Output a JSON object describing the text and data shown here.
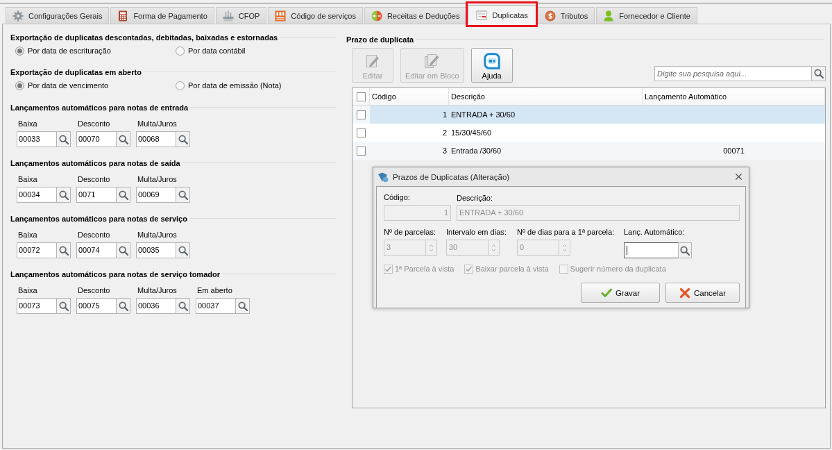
{
  "tabs": [
    {
      "label": "Configurações Gerais",
      "selected": false,
      "highlighted": false
    },
    {
      "label": "Forma de Pagamento",
      "selected": false,
      "highlighted": false
    },
    {
      "label": "CFOP",
      "selected": false,
      "highlighted": false
    },
    {
      "label": "Código de serviços",
      "selected": false,
      "highlighted": false
    },
    {
      "label": "Receitas e Deduções",
      "selected": false,
      "highlighted": false
    },
    {
      "label": "Duplicatas",
      "selected": true,
      "highlighted": true
    },
    {
      "label": "Tributos",
      "selected": false,
      "highlighted": false
    },
    {
      "label": "Fornecedor e Cliente",
      "selected": false,
      "highlighted": false
    }
  ],
  "export_settings": [
    {
      "title": "Exportação de duplicatas descontadas, debitadas, baixadas e estornadas",
      "options": [
        {
          "label": "Por data de escrituração",
          "selected": true
        },
        {
          "label": "Por data contábil",
          "selected": false
        }
      ]
    },
    {
      "title": "Exportação de duplicatas em aberto",
      "options": [
        {
          "label": "Por data de vencimento",
          "selected": true
        },
        {
          "label": "Por data de emissão (Nota)",
          "selected": false
        }
      ]
    }
  ],
  "automatic_entries": [
    {
      "title": "Lançamentos automáticos para notas de entrada",
      "fields": [
        {
          "label": "Baixa",
          "value": "00033"
        },
        {
          "label": "Desconto",
          "value": "00070"
        },
        {
          "label": "Multa/Juros",
          "value": "00068"
        }
      ]
    },
    {
      "title": "Lançamentos automáticos para notas de saída",
      "fields": [
        {
          "label": "Baixa",
          "value": "00034"
        },
        {
          "label": "Desconto",
          "value": "0071"
        },
        {
          "label": "Multa/Juros",
          "value": "00069"
        }
      ]
    },
    {
      "title": "Lançamentos automáticos para notas de serviço",
      "fields": [
        {
          "label": "Baixa",
          "value": "00072"
        },
        {
          "label": "Desconto",
          "value": "00074"
        },
        {
          "label": "Multa/Juros",
          "value": "00035"
        }
      ]
    },
    {
      "title": "Lançamentos automáticos para notas de serviço tomador",
      "fields": [
        {
          "label": "Baixa",
          "value": "00073"
        },
        {
          "label": "Desconto",
          "value": "00075"
        },
        {
          "label": "Multa/Juros",
          "value": "00036"
        },
        {
          "label": "Em aberto",
          "value": "00037"
        }
      ]
    }
  ],
  "due_terms": {
    "title": "Prazo de duplicata",
    "toolbar": [
      {
        "label": "Editar",
        "disabled": true
      },
      {
        "label": "Editar em Bloco",
        "disabled": true
      },
      {
        "label": "Ajuda",
        "disabled": false
      }
    ],
    "search": {
      "placeholder": "Digite sua pesquisa aqui..."
    },
    "table": {
      "header_checked": false,
      "columns": [
        "Código",
        "Descrição",
        "Lançamento Automático"
      ],
      "rows": [
        {
          "checked": false,
          "selected": true,
          "code": "1",
          "description": "ENTRADA + 30/60"
        },
        {
          "checked": false,
          "selected": false,
          "code": "2",
          "description": "15/30/45/60"
        },
        {
          "checked": false,
          "selected": false,
          "code": "3",
          "description": "Entrada /30/60",
          "auto_entry": "00071"
        }
      ]
    }
  },
  "dialog": {
    "title": "Prazos de Duplicatas (Alteração)",
    "code": {
      "label": "Código:",
      "value": "1",
      "disabled": true
    },
    "description": {
      "label": "Descrição:",
      "value": "ENTRADA + 30/60",
      "disabled": true
    },
    "spinners": [
      {
        "label": "Nº de parcelas:",
        "value": "3",
        "disabled": true
      },
      {
        "label": "Intervalo em dias:",
        "value": "30",
        "disabled": true
      },
      {
        "label": "Nº de dias para a 1ª parcela:",
        "value": "0",
        "disabled": true
      }
    ],
    "auto_entry": {
      "label": "Lanç. Automático:",
      "focused": true
    },
    "options": [
      {
        "label": "1ª Parcela à vista",
        "checked": true,
        "disabled": true
      },
      {
        "label": "Baixar parcela à vista",
        "checked": true,
        "disabled": true
      },
      {
        "label": "Sugerir número da duplicata",
        "checked": false,
        "disabled": true
      }
    ],
    "buttons": [
      {
        "label": "Gravar",
        "kind": "confirm"
      },
      {
        "label": "Cancelar",
        "kind": "cancel"
      }
    ]
  }
}
